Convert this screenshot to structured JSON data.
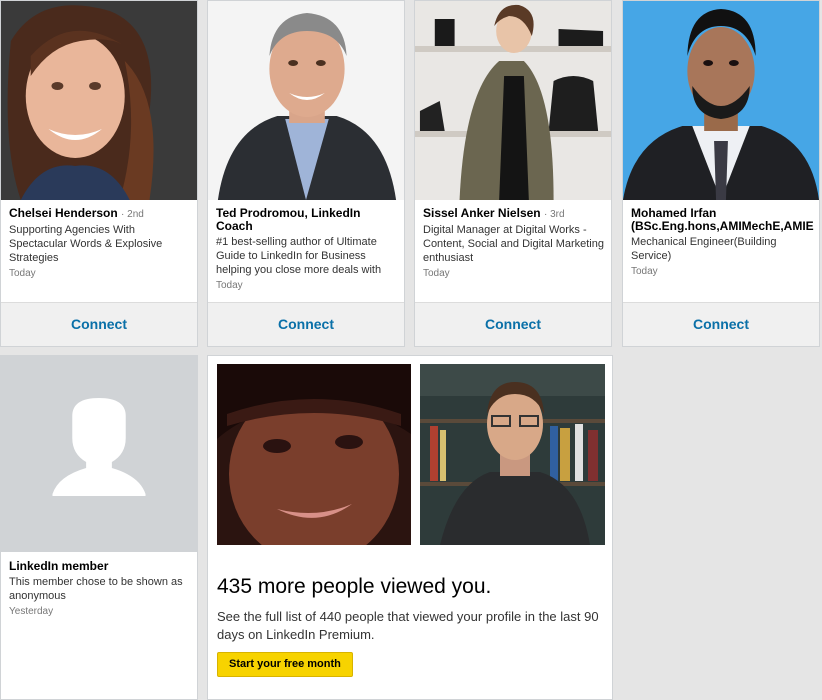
{
  "suggestions": [
    {
      "name": "Chelsei Henderson",
      "degree": "2nd",
      "headline": "Supporting Agencies With Spectacular Words & Explosive Strategies",
      "time": "Today",
      "connect_label": "Connect"
    },
    {
      "name": "Ted Prodromou, LinkedIn Coach",
      "degree": "",
      "headline": "#1 best-selling author of Ultimate Guide to LinkedIn for Business helping you close more deals with",
      "time": "Today",
      "connect_label": "Connect"
    },
    {
      "name": "Sissel Anker Nielsen",
      "degree": "3rd",
      "headline": "Digital Manager at Digital Works - Content, Social and Digital Marketing enthusiast",
      "time": "Today",
      "connect_label": "Connect"
    },
    {
      "name": "Mohamed Irfan (BSc.Eng.hons,AMIMechE,AMIE",
      "degree": "",
      "headline": "Mechanical Engineer(Building Service)",
      "time": "Today",
      "connect_label": "Connect"
    }
  ],
  "member": {
    "name": "LinkedIn member",
    "headline": "This member chose to be shown as anonymous",
    "time": "Yesterday"
  },
  "premium": {
    "title": "435 more people viewed you.",
    "description": "See the full list of 440 people that viewed your profile in the last 90 days on LinkedIn Premium.",
    "cta_label": "Start your free month"
  },
  "colors": {
    "connect_text": "#0a70a8",
    "cta_background": "#f7d300",
    "page_background": "#e5e5e5"
  }
}
